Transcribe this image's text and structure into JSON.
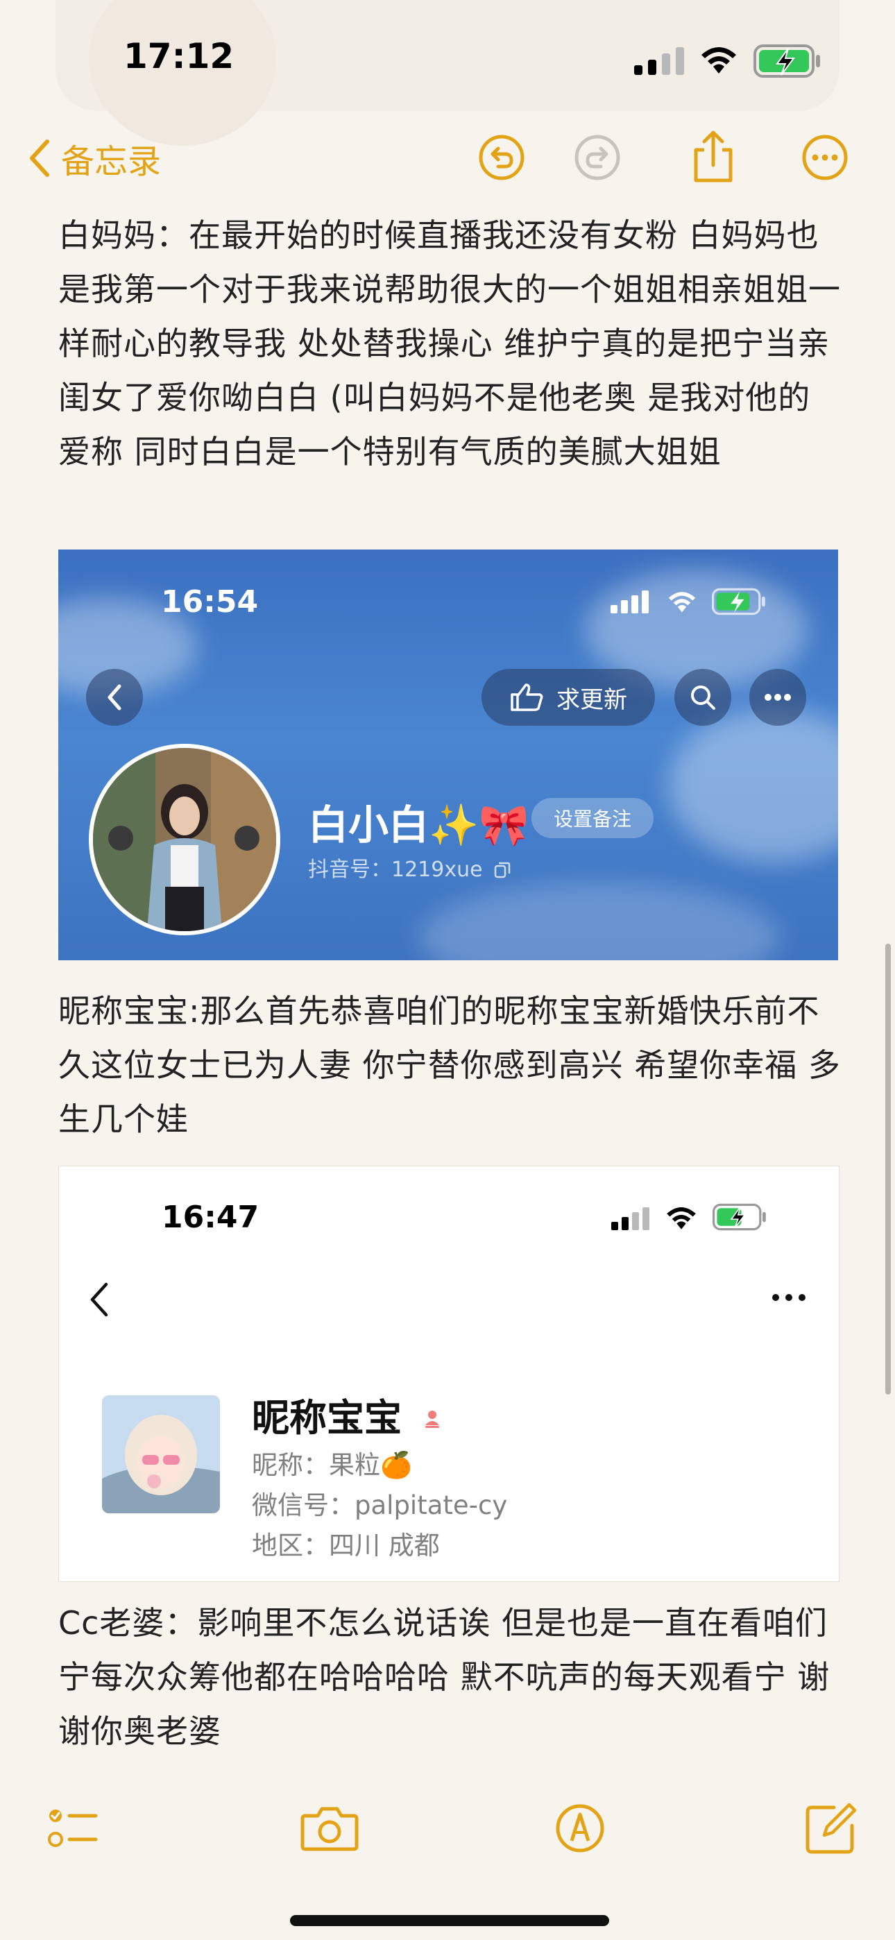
{
  "status_bar": {
    "time": "17:12"
  },
  "nav": {
    "back_label": "备忘录"
  },
  "note": {
    "paragraph1": "白妈妈：在最开始的时候直播我还没有女粉 白妈妈也是我第一个对于我来说帮助很大的一个姐姐相亲姐姐一样耐心的教导我 处处替我操心 维护宁真的是把宁当亲闺女了爱你呦白白 (叫白妈妈不是他老奥 是我对他的爱称 同时白白是一个特别有气质的美腻大姐姐",
    "paragraph2": "昵称宝宝:那么首先恭喜咱们的昵称宝宝新婚快乐前不久这位女士已为人妻  你宁替你感到高兴 希望你幸福 多生几个娃",
    "paragraph3": "Cc老婆：影响里不怎么说话诶 但是也是一直在看咱们宁每次众筹他都在哈哈哈哈 默不吭声的每天观看宁 谢谢你奥老婆"
  },
  "screenshot1": {
    "time": "16:54",
    "update_button": "求更新",
    "name": "白小白✨🎀",
    "set_note": "设置备注",
    "douyin_id": "抖音号：1219xue"
  },
  "screenshot2": {
    "time": "16:47",
    "name": "昵称宝宝",
    "nickname": "昵称：果粒🍊",
    "wechat_id": "微信号：palpitate-cy",
    "region": "地区：四川 成都"
  },
  "colors": {
    "accent": "#e2a316",
    "background": "#f7f4ee"
  }
}
